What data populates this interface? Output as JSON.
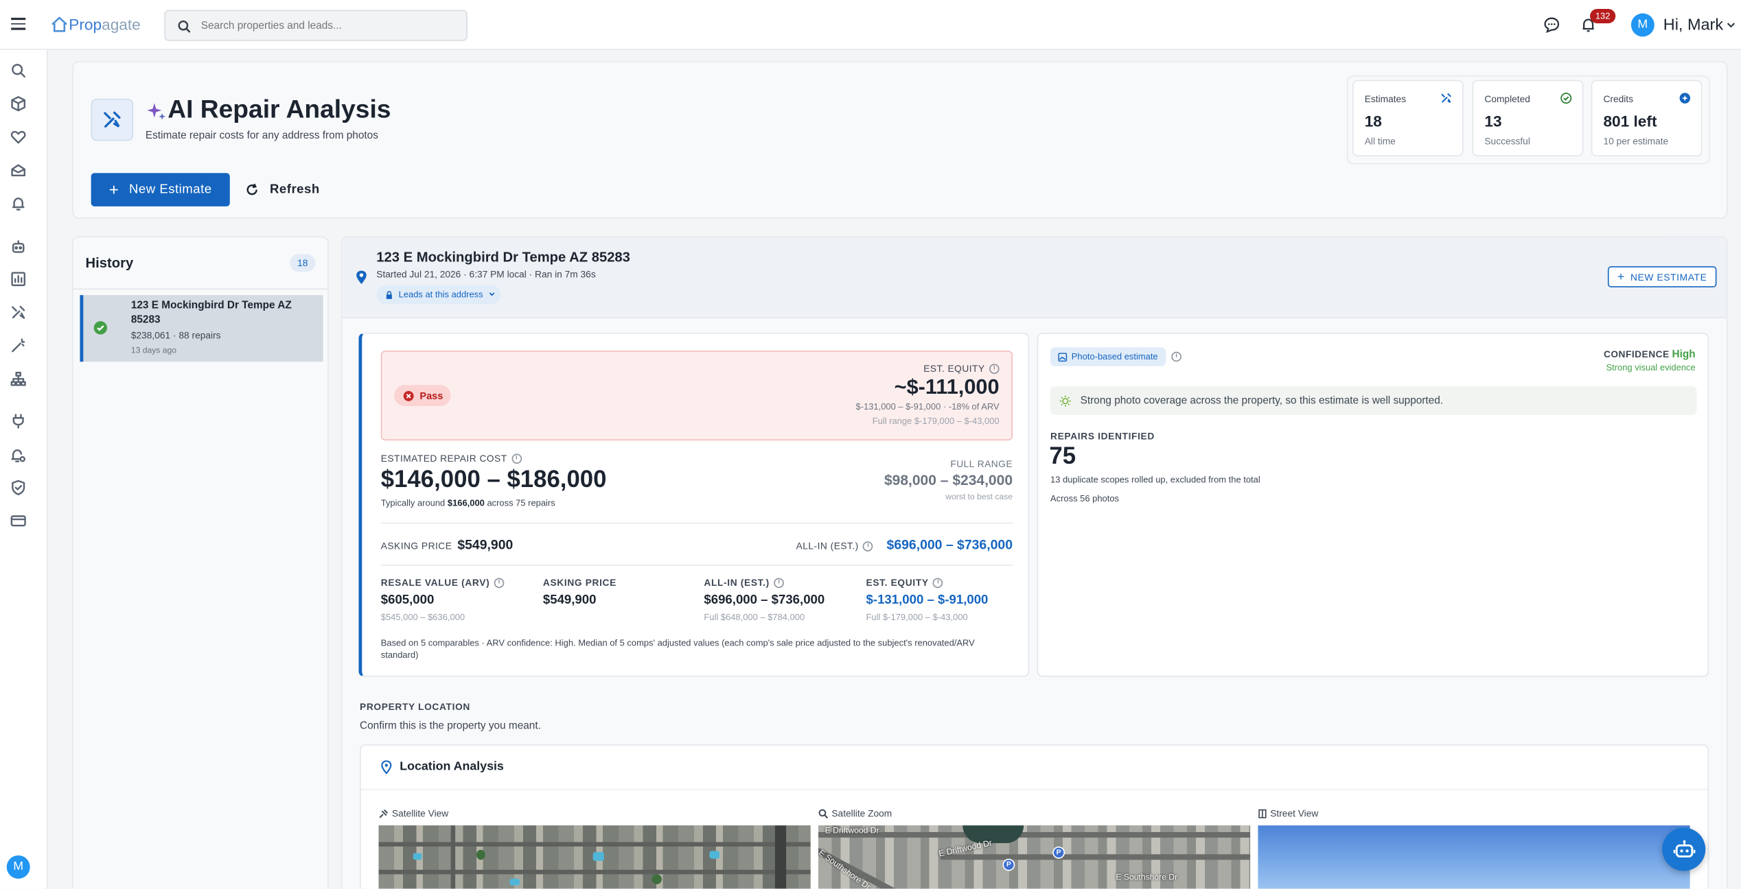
{
  "app": {
    "brand_prefix": "Prop",
    "brand_suffix": "agate",
    "search_placeholder": "Search properties and leads...",
    "notifications_count": "132",
    "user_initial": "M",
    "user_greeting": "Hi, Mark"
  },
  "header": {
    "title": "AI Repair Analysis",
    "subtitle": "Estimate repair costs for any address from photos",
    "new_estimate_label": "New Estimate",
    "refresh_label": "Refresh"
  },
  "stats": [
    {
      "title": "Estimates",
      "value": "18",
      "sub": "All time"
    },
    {
      "title": "Completed",
      "value": "13",
      "sub": "Successful"
    },
    {
      "title": "Credits",
      "value": "801 left",
      "sub": "10 per estimate"
    }
  ],
  "history": {
    "title": "History",
    "count": "18",
    "items": [
      {
        "address": "123 E Mockingbird Dr Tempe AZ 85283",
        "meta": "$238,061 · 88 repairs",
        "age": "13 days ago"
      }
    ]
  },
  "detail": {
    "address": "123 E Mockingbird Dr Tempe AZ 85283",
    "started": "Started Jul 21, 2026 · 6:37 PM local · Ran in 7m 36s",
    "leads_label": "Leads at this address",
    "new_estimate_label": "NEW ESTIMATE",
    "verdict": "Pass",
    "equity_label": "EST. EQUITY",
    "equity_value": "~$-111,000",
    "equity_range": "$-131,000 – $-91,000 · -18% of ARV",
    "equity_full": "Full range $-179,000 – $-43,000",
    "repair_label": "ESTIMATED REPAIR COST",
    "repair_range": "$146,000 – $186,000",
    "repair_typical_pre": "Typically around",
    "repair_typical_val": "$166,000",
    "repair_typical_post": "across 75 repairs",
    "full_range_label": "FULL RANGE",
    "full_range_value": "$98,000 – $234,000",
    "full_range_sub": "worst to best case",
    "asking_label": "ASKING PRICE",
    "asking_value": "$549,900",
    "allin_label": "ALL-IN (EST.)",
    "allin_value": "$696,000 – $736,000",
    "metrics": [
      {
        "label": "RESALE VALUE (ARV)",
        "value": "$605,000",
        "sub": "$545,000 – $636,000"
      },
      {
        "label": "ASKING PRICE",
        "value": "$549,900",
        "sub": ""
      },
      {
        "label": "ALL-IN (EST.)",
        "value": "$696,000 – $736,000",
        "sub": "Full $648,000 – $784,000"
      },
      {
        "label": "EST. EQUITY",
        "value": "$-131,000 – $-91,000",
        "sub": "Full $-179,000 – $-43,000"
      }
    ],
    "comps_note": "Based on 5 comparables · ARV confidence: High. Median of 5 comps' adjusted values (each comp's sale price adjusted to the subject's renovated/ARV standard)",
    "photo_badge": "Photo-based estimate",
    "confidence_label": "CONFIDENCE",
    "confidence_value": "High",
    "confidence_sub": "Strong visual evidence",
    "coverage_note": "Strong photo coverage across the property, so this estimate is well supported.",
    "repairs_label": "REPAIRS IDENTIFIED",
    "repairs_value": "75",
    "repairs_dup": "13 duplicate scopes rolled up, excluded from the total",
    "repairs_photos": "Across 56 photos"
  },
  "location": {
    "section_title": "PROPERTY LOCATION",
    "section_sub": "Confirm this is the property you meant.",
    "card_title": "Location Analysis",
    "views": [
      "Satellite View",
      "Satellite Zoom",
      "Street View"
    ],
    "map_labels": [
      "E Driftwood Dr",
      "E Driftwood Dr",
      "E Southshore Dr",
      "E Southshore Dr"
    ]
  },
  "colors": {
    "primary": "#1565c0",
    "success": "#2e7d32",
    "danger": "#c62828",
    "badge": "#b71c1c"
  }
}
